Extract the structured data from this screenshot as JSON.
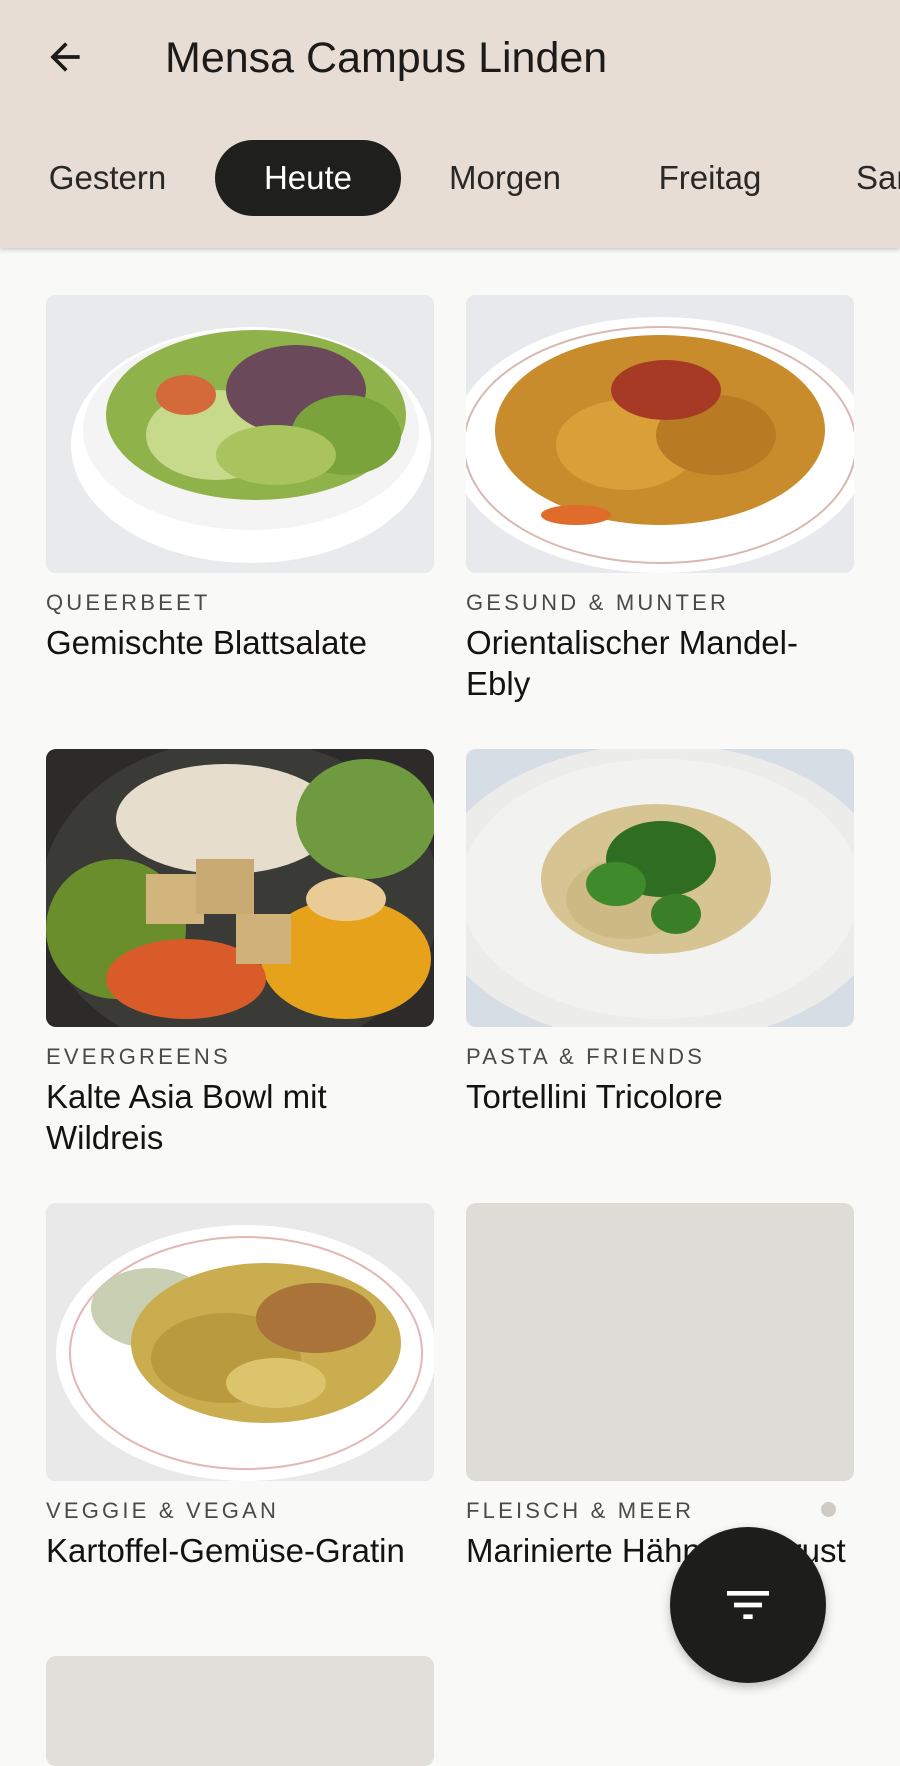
{
  "app_bar": {
    "title": "Mensa Campus Linden",
    "back_icon": "arrow-left-icon",
    "background": "#e7ddd4"
  },
  "day_tabs": [
    {
      "label": "Gestern",
      "active": false
    },
    {
      "label": "Heute",
      "active": true
    },
    {
      "label": "Morgen",
      "active": false
    },
    {
      "label": "Freitag",
      "active": false
    },
    {
      "label": "Samstag",
      "active": false
    }
  ],
  "dishes": [
    {
      "category": "QUEERBEET",
      "name": "Gemischte Blattsalate",
      "image": "mixed-salad-photo"
    },
    {
      "category": "GESUND & MUNTER",
      "name": "Orientalischer Mandel-Ebly",
      "image": "ebly-plate-photo"
    },
    {
      "category": "EVERGREENS",
      "name": "Kalte Asia Bowl mit Wildreis",
      "image": "asia-bowl-photo"
    },
    {
      "category": "PASTA & FRIENDS",
      "name": "Tortellini Tricolore",
      "image": "tortellini-photo"
    },
    {
      "category": "VEGGIE & VEGAN",
      "name": "Kartoffel-Gemüse-Gratin",
      "image": "gratin-photo"
    },
    {
      "category": "FLEISCH & MEER",
      "name": "Marinierte Hähnchenbrust",
      "image": "image-placeholder"
    }
  ],
  "fab": {
    "icon": "filter-icon"
  },
  "colors": {
    "accent_dark": "#1f1f1e",
    "page_background": "#f9f9f8",
    "placeholder": "#dedcd6"
  }
}
